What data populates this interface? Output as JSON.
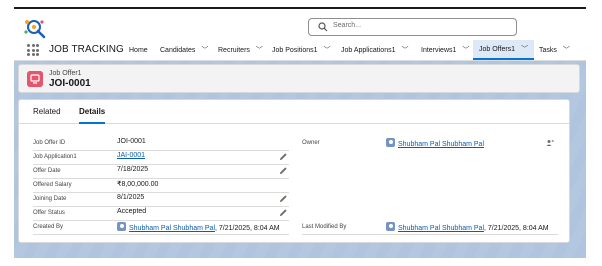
{
  "header": {
    "search_placeholder": "Search..."
  },
  "nav": {
    "app_name": "JOB TRACKING",
    "items": [
      {
        "label": "Home",
        "has_menu": false
      },
      {
        "label": "Candidates",
        "has_menu": true
      },
      {
        "label": "Recruiters",
        "has_menu": true
      },
      {
        "label": "Job Positions1",
        "has_menu": true
      },
      {
        "label": "Job Applications1",
        "has_menu": true
      },
      {
        "label": "Interviews1",
        "has_menu": true
      },
      {
        "label": "Job Offers1",
        "has_menu": true,
        "active": true
      },
      {
        "label": "Tasks",
        "has_menu": true
      }
    ]
  },
  "record": {
    "object_label": "Job Offer1",
    "name": "JOI-0001",
    "icon_color": "#e3566b"
  },
  "tabs": [
    {
      "label": "Related",
      "active": false
    },
    {
      "label": "Details",
      "active": true
    }
  ],
  "fields": {
    "job_offer_id": {
      "label": "Job Offer ID",
      "value": "JOI-0001"
    },
    "job_application": {
      "label": "Job Application1",
      "value": "JAI-0001"
    },
    "offer_date": {
      "label": "Offer Date",
      "value": "7/18/2025"
    },
    "offered_salary": {
      "label": "Offered Salary",
      "value": "₹8,00,000.00"
    },
    "joining_date": {
      "label": "Joining Date",
      "value": "8/1/2025"
    },
    "offer_status": {
      "label": "Offer Status",
      "value": "Accepted"
    },
    "created_by": {
      "label": "Created By",
      "user": "Shubham Pal Shubham Pal",
      "timestamp": ", 7/21/2025, 8:04 AM"
    },
    "owner": {
      "label": "Owner",
      "user": "Shubham Pal Shubham Pal"
    },
    "last_modified_by": {
      "label": "Last Modified By",
      "user": "Shubham Pal Shubham Pal",
      "timestamp": ", 7/21/2025, 8:04 AM"
    }
  },
  "colors": {
    "accent": "#0176d3",
    "link": "#0b5cab",
    "page_background": "#b0c4df",
    "active_tab_background": "#dee9f7"
  }
}
